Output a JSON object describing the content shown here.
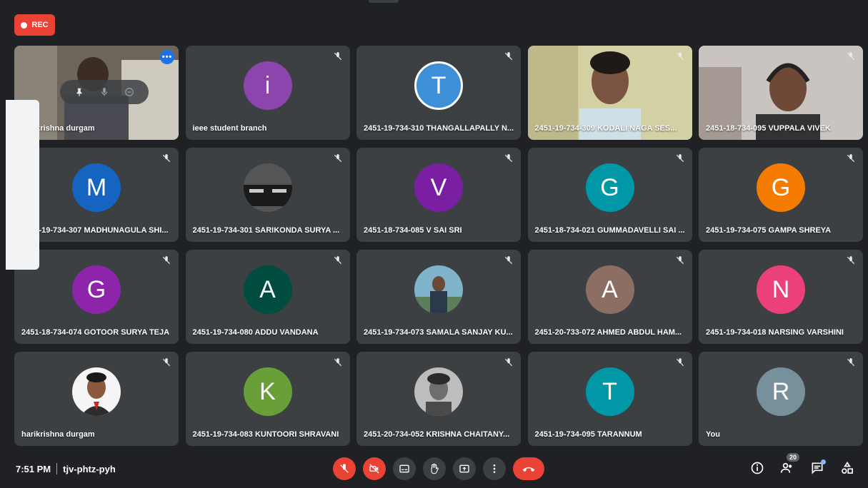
{
  "rec_label": "REC",
  "meeting": {
    "time": "7:51 PM",
    "code": "tjv-phtz-pyh"
  },
  "participant_count": "20",
  "colors": {
    "accent": "#8ab4f8",
    "danger": "#ea4335",
    "tile": "#3c4043",
    "bg": "#202124"
  },
  "tiles": [
    {
      "name": "harikrishna durgam",
      "type": "video"
    },
    {
      "name": "ieee student branch",
      "initial": "i",
      "color": "#8e44ad"
    },
    {
      "name": "2451-19-734-310 THANGALLAPALLY N...",
      "initial": "T",
      "color": "#3d8fd8"
    },
    {
      "name": "2451-19-734-309 KODALI NAGA SES...",
      "type": "video"
    },
    {
      "name": "2451-18-734-095 VUPPALA VIVEK",
      "type": "video"
    },
    {
      "name": "2451-19-734-307 MADHUNAGULA SHI...",
      "initial": "M",
      "color": "#1565c0"
    },
    {
      "name": "2451-19-734-301 SARIKONDA SURYA ...",
      "type": "photo"
    },
    {
      "name": "2451-18-734-085 V SAI SRI",
      "initial": "V",
      "color": "#7b1fa2"
    },
    {
      "name": "2451-18-734-021 GUMMADAVELLI SAI ...",
      "initial": "G",
      "color": "#0097a7"
    },
    {
      "name": "2451-19-734-075 GAMPA SHREYA",
      "initial": "G",
      "color": "#f57c00"
    },
    {
      "name": "2451-18-734-074 GOTOOR SURYA TEJA",
      "initial": "G",
      "color": "#8e24aa"
    },
    {
      "name": "2451-19-734-080 ADDU VANDANA",
      "initial": "A",
      "color": "#004d40"
    },
    {
      "name": "2451-19-734-073 SAMALA SANJAY KU...",
      "type": "photo"
    },
    {
      "name": "2451-20-733-072 AHMED ABDUL HAM...",
      "initial": "A",
      "color": "#8d6e63"
    },
    {
      "name": "2451-19-734-018 NARSING VARSHINI",
      "initial": "N",
      "color": "#ec407a"
    },
    {
      "name": "harikrishna durgam",
      "type": "photo"
    },
    {
      "name": "2451-19-734-083 KUNTOORI SHRAVANI",
      "initial": "K",
      "color": "#689f38"
    },
    {
      "name": "2451-20-734-052 KRISHNA CHAITANY...",
      "type": "photo"
    },
    {
      "name": "2451-19-734-095 TARANNUM",
      "initial": "T",
      "color": "#0097a7"
    },
    {
      "name": "You",
      "initial": "R",
      "color": "#78909c"
    }
  ]
}
